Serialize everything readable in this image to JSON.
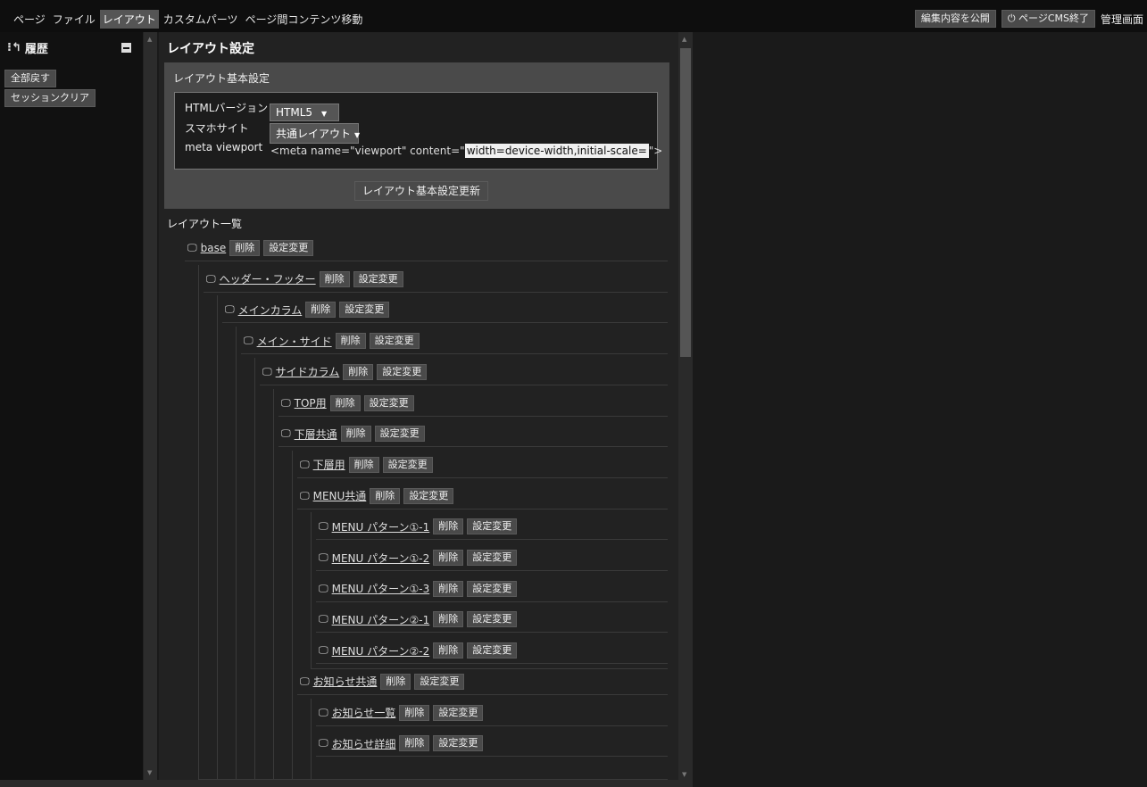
{
  "menu": [
    "ページ",
    "ファイル",
    "レイアウト",
    "カスタムパーツ",
    "ページ間コンテンツ移動"
  ],
  "menu_active_index": 2,
  "top_right": {
    "publish": "編集内容を公開",
    "exit": "ページCMS終了",
    "admin": "管理画面"
  },
  "history": {
    "title": "履歴",
    "undo_all": "全部戻す",
    "session_clear": "セッションクリア"
  },
  "layout": {
    "title": "レイアウト設定",
    "basic_title": "レイアウト基本設定",
    "html_version_label": "HTMLバージョン",
    "html_version_value": "HTML5",
    "sp_label": "スマホサイト",
    "sp_value": "共通レイアウト",
    "viewport_label": "meta viewport",
    "viewport_prefix": "<meta name=\"viewport\" content=\"",
    "viewport_value": "width=device-width,initial-scale=",
    "viewport_suffix": "\">",
    "update_button": "レイアウト基本設定更新",
    "list_title": "レイアウト一覧"
  },
  "buttons": {
    "delete": "削除",
    "change": "設定変更"
  },
  "tree": [
    {
      "name": "base",
      "depth": 0
    },
    {
      "name": "ヘッダー・フッター",
      "depth": 1
    },
    {
      "name": "メインカラム",
      "depth": 2
    },
    {
      "name": "メイン・サイド",
      "depth": 3
    },
    {
      "name": "サイドカラム",
      "depth": 4
    },
    {
      "name": "TOP用",
      "depth": 5
    },
    {
      "name": "下層共通",
      "depth": 5
    },
    {
      "name": "下層用",
      "depth": 6
    },
    {
      "name": "MENU共通",
      "depth": 6
    },
    {
      "name": "MENU パターン①-1",
      "depth": 7
    },
    {
      "name": "MENU パターン①-2",
      "depth": 7
    },
    {
      "name": "MENU パターン①-3",
      "depth": 7
    },
    {
      "name": "MENU パターン②-1",
      "depth": 7
    },
    {
      "name": "MENU パターン②-2",
      "depth": 7
    },
    {
      "name": "お知らせ共通",
      "depth": 6
    },
    {
      "name": "お知らせ一覧",
      "depth": 7
    },
    {
      "name": "お知らせ詳細",
      "depth": 7
    }
  ]
}
